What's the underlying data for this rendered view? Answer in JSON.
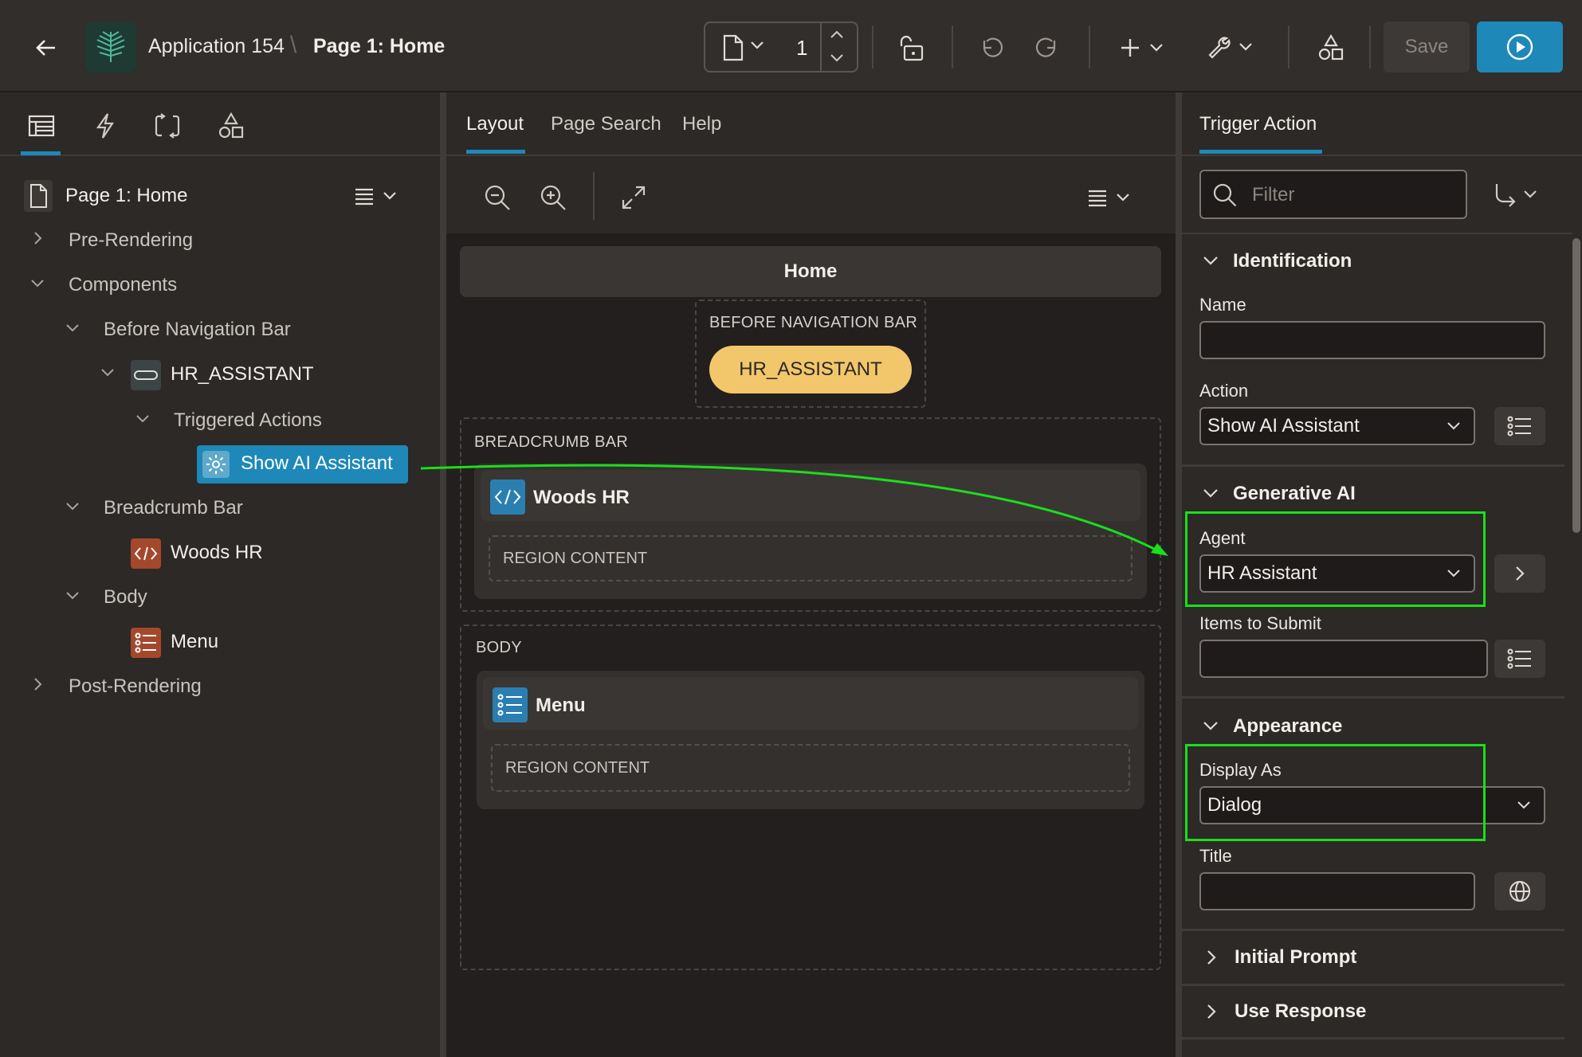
{
  "header": {
    "app_name": "Application 154",
    "breadcrumb_sep": "\\",
    "page_name": "Page 1: Home",
    "page_number": "1",
    "save_label": "Save"
  },
  "left": {
    "tree": {
      "root": "Page 1: Home",
      "pre_rendering": "Pre-Rendering",
      "components": "Components",
      "before_nav_bar": "Before Navigation Bar",
      "hr_assistant": "HR_ASSISTANT",
      "triggered_actions": "Triggered Actions",
      "show_ai_assistant": "Show AI Assistant",
      "breadcrumb_bar": "Breadcrumb Bar",
      "woods_hr": "Woods HR",
      "body": "Body",
      "menu": "Menu",
      "post_rendering": "Post-Rendering"
    }
  },
  "center": {
    "tabs": [
      "Layout",
      "Page Search",
      "Help"
    ],
    "page_title": "Home",
    "before_nav_label": "BEFORE NAVIGATION BAR",
    "hr_button": "HR_ASSISTANT",
    "breadcrumb_label": "BREADCRUMB BAR",
    "woods_hr": "Woods HR",
    "region_content_1": "REGION CONTENT",
    "body_label": "BODY",
    "menu": "Menu",
    "region_content_2": "REGION CONTENT"
  },
  "right": {
    "tab": "Trigger Action",
    "filter_placeholder": "Filter",
    "identification": {
      "title": "Identification",
      "name_label": "Name",
      "name_value": "",
      "action_label": "Action",
      "action_value": "Show AI Assistant"
    },
    "generative_ai": {
      "title": "Generative AI",
      "agent_label": "Agent",
      "agent_value": "HR Assistant",
      "items_label": "Items to Submit",
      "items_value": ""
    },
    "appearance": {
      "title": "Appearance",
      "display_as_label": "Display As",
      "display_as_value": "Dialog",
      "title_label": "Title",
      "title_value": ""
    },
    "initial_prompt": "Initial Prompt",
    "use_response": "Use Response"
  },
  "colors": {
    "accent": "#1e88b8",
    "highlight_green": "#19e019",
    "hr_button": "#f2c76b",
    "woods_icon": "#2a7fb0",
    "menu_icon": "#2a7fb0",
    "static_icon": "#a4482c"
  }
}
